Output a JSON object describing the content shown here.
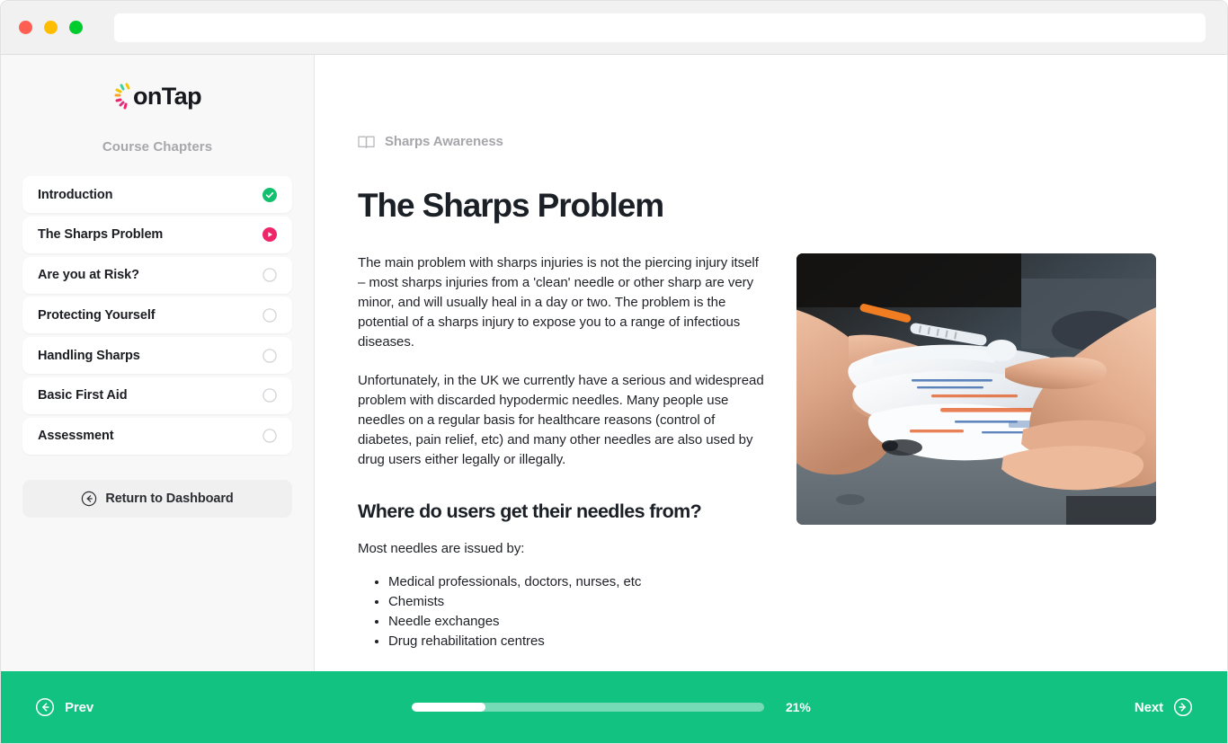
{
  "browser": {
    "traffic_lights": [
      {
        "name": "close",
        "color": "#ff5f52"
      },
      {
        "name": "minimize",
        "color": "#ffbd00"
      },
      {
        "name": "maximize",
        "color": "#00cc2e"
      }
    ],
    "address_value": "",
    "address_placeholder": ""
  },
  "brand": {
    "logo_text": "onTap",
    "logo_dot_colors": [
      "#f2c500",
      "#4cd964",
      "#1dd1a1",
      "#ff3b6b",
      "#ff9f1c",
      "#d63384"
    ]
  },
  "sidebar": {
    "chapters_label": "Course Chapters",
    "chapters": [
      {
        "label": "Introduction",
        "status": "complete"
      },
      {
        "label": "The Sharps Problem",
        "status": "current"
      },
      {
        "label": "Are you at Risk?",
        "status": "locked"
      },
      {
        "label": "Protecting Yourself",
        "status": "locked"
      },
      {
        "label": "Handling Sharps",
        "status": "locked"
      },
      {
        "label": "Basic First Aid",
        "status": "locked"
      },
      {
        "label": "Assessment",
        "status": "locked"
      }
    ],
    "return_button": "Return to Dashboard"
  },
  "main": {
    "breadcrumb": "Sharps Awareness",
    "breadcrumb_icon": "book-icon",
    "title": "The Sharps Problem",
    "paragraphs": [
      "The main problem with sharps injuries is not the piercing injury itself – most sharps injuries from a 'clean' needle or other sharp are very minor, and will usually heal in a day or two. The problem is the potential of a sharps injury to expose you to a range of infectious diseases.",
      "Unfortunately, in the UK we currently have a serious and widespread problem with discarded hypodermic needles. Many people use needles on a regular basis for healthcare reasons (control of diabetes, pain relief, etc) and many other needles are also used by drug users either legally or illegally."
    ],
    "subheading": "Where do users get their needles from?",
    "lead": "Most needles are issued by:",
    "bullets": [
      "Medical professionals, doctors, nurses, etc",
      "Chemists",
      "Needle exchanges",
      "Drug rehabilitation centres"
    ],
    "image_alt": "Hands exchanging packaged hypodermic needles"
  },
  "footer": {
    "prev_label": "Prev",
    "next_label": "Next",
    "progress_percent": 21,
    "progress_text": "21%",
    "accent_color": "#12c281"
  },
  "colors": {
    "complete": "#13c06f",
    "current": "#ef2469",
    "locked": "#d3d4d8",
    "footer": "#12c281"
  }
}
